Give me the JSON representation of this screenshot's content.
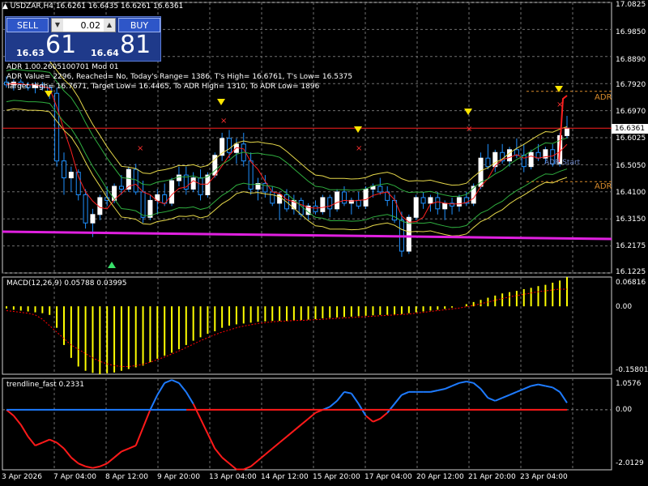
{
  "header": {
    "symbol_line": "USDZAR,H4  16.6261 16.6435 16.6261 16.6361"
  },
  "trade_panel": {
    "sell_label": "SELL",
    "buy_label": "BUY",
    "lot_value": "0.02",
    "bid_small": "16.63",
    "bid_big": "61",
    "ask_small": "16.64",
    "ask_big": "81"
  },
  "adr_info": [
    "ADR 1.00.2605100701 Mod 01",
    "ADR Value= 2296, Reached= No, Today's Range= 1386, T's High= 16.6761, T's Low= 16.5375",
    "Target High= 16.7671, Target Low= 16.4465, To ADR High= 1310, To ADR Low= 1896"
  ],
  "adr_label_high": "ADR",
  "adr_label_low": "ADR",
  "adr_start_label": "ADR Start",
  "current_price": "16.6361",
  "price_scale": [
    "17.0825",
    "16.9850",
    "16.8890",
    "16.7920",
    "16.6970",
    "16.6025",
    "16.5050",
    "16.4100",
    "16.3150",
    "16.2175",
    "16.1225"
  ],
  "macd": {
    "title": "MACD(12,26,9) 0.05788 0.03995",
    "scale": [
      "0.06816",
      "0.00",
      "-0.15801"
    ]
  },
  "trendline": {
    "title": "trendline_fast 0.2331",
    "scale": [
      "1.0576",
      "0.00",
      "-2.0129"
    ]
  },
  "time_axis": [
    "3 Apr 2026",
    "7 Apr 04:00",
    "8 Apr 12:00",
    "9 Apr 20:00",
    "13 Apr 04:00",
    "14 Apr 12:00",
    "15 Apr 20:00",
    "17 Apr 04:00",
    "20 Apr 12:00",
    "21 Apr 20:00",
    "23 Apr 04:00"
  ],
  "colors": {
    "up_candle": "#ffffff",
    "down_candle": "#1e90ff",
    "wick": "#1e90ff",
    "grid": "#6f6f6f",
    "magenta_line": "#e020e0",
    "resistance_line": "#ff2020",
    "macd_hist": "#ffff00",
    "signal": "#ff0000",
    "trend_blue": "#1e7bff",
    "trend_red": "#ff1a1a",
    "adr_label": "#d98b2b"
  },
  "chart_data": {
    "type": "candlestick",
    "timeframe": "H4",
    "price_range": [
      16.1225,
      17.0825
    ],
    "current_price": 16.6361,
    "candles": [
      [
        16.8,
        16.82,
        16.78,
        16.79
      ],
      [
        16.79,
        16.81,
        16.77,
        16.8
      ],
      [
        16.8,
        16.81,
        16.78,
        16.79
      ],
      [
        16.79,
        16.8,
        16.77,
        16.78
      ],
      [
        16.78,
        16.8,
        16.76,
        16.79
      ],
      [
        16.79,
        16.8,
        16.77,
        16.78
      ],
      [
        16.78,
        16.79,
        16.74,
        16.76
      ],
      [
        16.76,
        16.78,
        16.5,
        16.52
      ],
      [
        16.52,
        16.55,
        16.4,
        16.46
      ],
      [
        16.46,
        16.5,
        16.41,
        16.48
      ],
      [
        16.48,
        16.49,
        16.38,
        16.4
      ],
      [
        16.4,
        16.42,
        16.28,
        16.3
      ],
      [
        16.3,
        16.35,
        16.25,
        16.33
      ],
      [
        16.33,
        16.4,
        16.31,
        16.39
      ],
      [
        16.39,
        16.43,
        16.36,
        16.38
      ],
      [
        16.38,
        16.44,
        16.37,
        16.43
      ],
      [
        16.43,
        16.47,
        16.4,
        16.42
      ],
      [
        16.42,
        16.5,
        16.41,
        16.49
      ],
      [
        16.49,
        16.51,
        16.4,
        16.41
      ],
      [
        16.41,
        16.45,
        16.3,
        16.32
      ],
      [
        16.32,
        16.4,
        16.31,
        16.38
      ],
      [
        16.38,
        16.42,
        16.33,
        16.4
      ],
      [
        16.4,
        16.44,
        16.36,
        16.37
      ],
      [
        16.37,
        16.46,
        16.36,
        16.45
      ],
      [
        16.45,
        16.5,
        16.43,
        16.47
      ],
      [
        16.47,
        16.5,
        16.4,
        16.42
      ],
      [
        16.42,
        16.48,
        16.41,
        16.46
      ],
      [
        16.46,
        16.49,
        16.38,
        16.4
      ],
      [
        16.4,
        16.48,
        16.39,
        16.47
      ],
      [
        16.47,
        16.55,
        16.46,
        16.54
      ],
      [
        16.54,
        16.62,
        16.52,
        16.6
      ],
      [
        16.6,
        16.63,
        16.53,
        16.55
      ],
      [
        16.55,
        16.6,
        16.51,
        16.58
      ],
      [
        16.58,
        16.62,
        16.5,
        16.52
      ],
      [
        16.52,
        16.55,
        16.4,
        16.42
      ],
      [
        16.42,
        16.46,
        16.38,
        16.44
      ],
      [
        16.44,
        16.47,
        16.39,
        16.41
      ],
      [
        16.41,
        16.43,
        16.36,
        16.37
      ],
      [
        16.37,
        16.41,
        16.31,
        16.4
      ],
      [
        16.4,
        16.42,
        16.34,
        16.35
      ],
      [
        16.35,
        16.4,
        16.33,
        16.38
      ],
      [
        16.38,
        16.39,
        16.32,
        16.33
      ],
      [
        16.33,
        16.37,
        16.31,
        16.36
      ],
      [
        16.36,
        16.38,
        16.33,
        16.34
      ],
      [
        16.34,
        16.4,
        16.33,
        16.39
      ],
      [
        16.39,
        16.4,
        16.32,
        16.35
      ],
      [
        16.35,
        16.42,
        16.34,
        16.41
      ],
      [
        16.41,
        16.43,
        16.36,
        16.37
      ],
      [
        16.37,
        16.39,
        16.33,
        16.38
      ],
      [
        16.38,
        16.41,
        16.35,
        16.36
      ],
      [
        16.36,
        16.43,
        16.35,
        16.42
      ],
      [
        16.42,
        16.44,
        16.39,
        16.43
      ],
      [
        16.43,
        16.46,
        16.4,
        16.41
      ],
      [
        16.41,
        16.43,
        16.36,
        16.38
      ],
      [
        16.38,
        16.4,
        16.3,
        16.31
      ],
      [
        16.31,
        16.34,
        16.18,
        16.2
      ],
      [
        16.2,
        16.33,
        16.19,
        16.32
      ],
      [
        16.32,
        16.4,
        16.31,
        16.39
      ],
      [
        16.39,
        16.41,
        16.35,
        16.37
      ],
      [
        16.37,
        16.4,
        16.34,
        16.39
      ],
      [
        16.39,
        16.41,
        16.33,
        16.35
      ],
      [
        16.35,
        16.38,
        16.31,
        16.37
      ],
      [
        16.37,
        16.39,
        16.33,
        16.36
      ],
      [
        16.36,
        16.4,
        16.34,
        16.39
      ],
      [
        16.39,
        16.41,
        16.36,
        16.37
      ],
      [
        16.37,
        16.44,
        16.36,
        16.43
      ],
      [
        16.43,
        16.55,
        16.42,
        16.53
      ],
      [
        16.53,
        16.58,
        16.49,
        16.5
      ],
      [
        16.5,
        16.56,
        16.48,
        16.55
      ],
      [
        16.55,
        16.58,
        16.51,
        16.52
      ],
      [
        16.52,
        16.57,
        16.5,
        16.56
      ],
      [
        16.56,
        16.6,
        16.53,
        16.54
      ],
      [
        16.54,
        16.58,
        16.48,
        16.5
      ],
      [
        16.5,
        16.56,
        16.49,
        16.55
      ],
      [
        16.55,
        16.58,
        16.52,
        16.53
      ],
      [
        16.53,
        16.57,
        16.51,
        16.56
      ],
      [
        16.56,
        16.58,
        16.5,
        16.51
      ],
      [
        16.51,
        16.62,
        16.5,
        16.61
      ],
      [
        16.61,
        16.68,
        16.6,
        16.6361
      ]
    ],
    "macd_hist": [
      -0.005,
      -0.008,
      -0.01,
      -0.012,
      -0.014,
      -0.016,
      -0.02,
      -0.05,
      -0.09,
      -0.12,
      -0.14,
      -0.15,
      -0.155,
      -0.158,
      -0.156,
      -0.154,
      -0.15,
      -0.146,
      -0.142,
      -0.138,
      -0.13,
      -0.122,
      -0.115,
      -0.108,
      -0.1,
      -0.09,
      -0.08,
      -0.072,
      -0.064,
      -0.058,
      -0.05,
      -0.045,
      -0.042,
      -0.04,
      -0.038,
      -0.036,
      -0.035,
      -0.034,
      -0.034,
      -0.034,
      -0.033,
      -0.032,
      -0.031,
      -0.03,
      -0.028,
      -0.027,
      -0.026,
      -0.025,
      -0.024,
      -0.023,
      -0.022,
      -0.021,
      -0.02,
      -0.02,
      -0.019,
      -0.018,
      -0.016,
      -0.014,
      -0.012,
      -0.01,
      -0.008,
      -0.006,
      -0.003,
      0.0,
      0.005,
      0.01,
      0.015,
      0.02,
      0.025,
      0.03,
      0.033,
      0.036,
      0.04,
      0.043,
      0.047,
      0.05,
      0.055,
      0.06,
      0.068
    ],
    "macd_signal": [
      -0.01,
      -0.012,
      -0.014,
      -0.016,
      -0.02,
      -0.03,
      -0.045,
      -0.06,
      -0.075,
      -0.09,
      -0.1,
      -0.11,
      -0.12,
      -0.128,
      -0.134,
      -0.138,
      -0.14,
      -0.14,
      -0.138,
      -0.135,
      -0.13,
      -0.124,
      -0.118,
      -0.111,
      -0.104,
      -0.096,
      -0.088,
      -0.08,
      -0.073,
      -0.066,
      -0.06,
      -0.055,
      -0.05,
      -0.046,
      -0.043,
      -0.04,
      -0.038,
      -0.036,
      -0.035,
      -0.034,
      -0.033,
      -0.033,
      -0.032,
      -0.031,
      -0.03,
      -0.029,
      -0.028,
      -0.027,
      -0.026,
      -0.025,
      -0.024,
      -0.023,
      -0.022,
      -0.021,
      -0.02,
      -0.019,
      -0.018,
      -0.016,
      -0.014,
      -0.012,
      -0.01,
      -0.008,
      -0.006,
      -0.004,
      -0.001,
      0.002,
      0.006,
      0.01,
      0.014,
      0.018,
      0.022,
      0.025,
      0.028,
      0.031,
      0.034,
      0.036,
      0.038,
      0.04,
      0.04
    ],
    "trendline_fast": [
      0.0,
      -0.2,
      -0.5,
      -0.9,
      -1.2,
      -1.1,
      -1.0,
      -1.1,
      -1.3,
      -1.6,
      -1.8,
      -1.9,
      -1.95,
      -1.9,
      -1.8,
      -1.6,
      -1.4,
      -1.3,
      -1.2,
      -0.6,
      0.0,
      0.5,
      0.9,
      1.0,
      0.9,
      0.6,
      0.2,
      -0.3,
      -0.8,
      -1.3,
      -1.6,
      -1.8,
      -2.0,
      -2.0,
      -1.9,
      -1.7,
      -1.5,
      -1.3,
      -1.1,
      -0.9,
      -0.7,
      -0.5,
      -0.3,
      -0.1,
      0.0,
      0.1,
      0.3,
      0.6,
      0.55,
      0.2,
      -0.2,
      -0.4,
      -0.3,
      -0.1,
      0.2,
      0.5,
      0.6,
      0.6,
      0.6,
      0.6,
      0.65,
      0.7,
      0.8,
      0.9,
      0.95,
      0.9,
      0.7,
      0.4,
      0.3,
      0.4,
      0.5,
      0.6,
      0.7,
      0.8,
      0.85,
      0.8,
      0.75,
      0.6,
      0.2331
    ]
  }
}
